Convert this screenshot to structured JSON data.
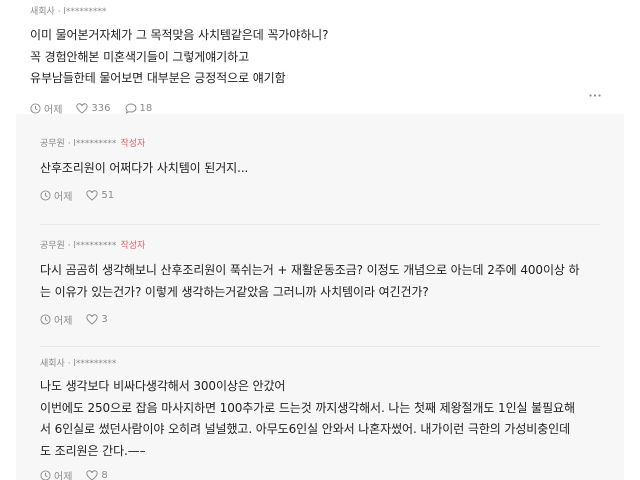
{
  "main_comment": {
    "author": "새회사 · l*********",
    "lines": [
      "이미 물어본거자체가 그 목적맞음 사치템같은데 꼭가야하니?",
      "꼭 경험안해본 미혼색기들이 그렇게얘기하고",
      "유부남들한테 물어보면 대부분은 긍정적으로 얘기함"
    ],
    "time": "어제",
    "likes": "336",
    "replies": "18"
  },
  "replies": [
    {
      "author": "공무원 · l*********",
      "tag": "작성자",
      "lines": [
        "산후조리원이 어쩌다가 사치템이 된거지..."
      ],
      "time": "어제",
      "likes": "51"
    },
    {
      "author": "공무원 · l*********",
      "tag": "작성자",
      "lines": [
        "다시 곰곰히 생각해보니 산후조리원이 푹쉬는거 + 재활운동조금? 이정도 개념으로 아는데 2주에 400이상 하",
        "는 이유가 있는건가? 이렇게 생각하는거같았음 그러니까 사치템이라 여긴건가?"
      ],
      "time": "어제",
      "likes": "3"
    },
    {
      "author": "새회사 · l*********",
      "tag": "",
      "lines": [
        "나도 생각보다 비싸다생각해서 300이상은 안갔어",
        "이번에도 250으로 잡음 마사지하면 100추가로 드는것 까지생각해서. 나는 첫째 제왕절개도 1인실 불필요해",
        "서 6인실로 썼던사람이야 오히려 널널했고. 아무도6인실 안와서 나혼자썼어. 내가이런 극한의 가성비충인데",
        "도 조리원은 간다.—–"
      ],
      "time": "어제",
      "likes": "8"
    }
  ]
}
